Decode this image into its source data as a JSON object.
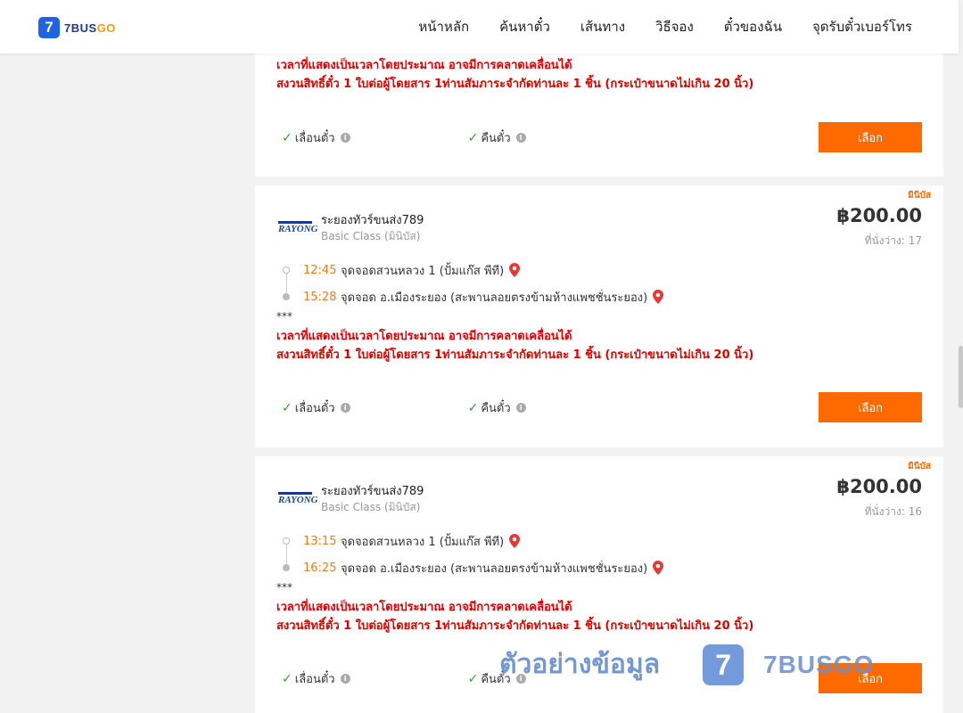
{
  "header": {
    "logo_text_main": "7BUS",
    "logo_text_accent": "GO",
    "logo_mark": "7",
    "nav": [
      "หน้าหลัก",
      "ค้นหาตั๋ว",
      "เส้นทาง",
      "วิธีจอง",
      "ตั๋วของฉัน",
      "จุดรับตั๋วเบอร์โทร"
    ]
  },
  "notice_lines": [
    "เวลาที่แสดงเป็นเวลาโดยประมาณ อาจมีการคลาดเคลื่อนได้",
    "สงวนสิทธิ์ตั๋ว 1 ใบต่อผู้โดยสาร 1ท่านสัมภาระจำกัดท่านละ 1 ชิ้น (กระเป๋าขนาดไม่เกิน 20 นิ้ว)"
  ],
  "features": {
    "change": "เลื่อนตั๋ว",
    "refund": "คืนตั๋ว"
  },
  "select_label": "เลือก",
  "trips": [
    {
      "tag": "มินิบัส",
      "operator": "ระยองทัวร์ขนส่ง789",
      "logo_text": "RAYONG",
      "class": "Basic Class (มินิบัส)",
      "price": "฿200.00",
      "seats": "ที่นั่งว่าง: 17",
      "depart_time": "12:45",
      "depart_place": "จุดจอดสวนหลวง 1 (ปั้มแก๊ส พีที)",
      "arrive_time": "15:28",
      "arrive_place": "จุดจอด อ.เมืองระยอง (สะพานลอยตรงข้ามห้างแพชชั่นระยอง)",
      "stars": "***"
    },
    {
      "tag": "มินิบัส",
      "operator": "ระยองทัวร์ขนส่ง789",
      "logo_text": "RAYONG",
      "class": "Basic Class (มินิบัส)",
      "price": "฿200.00",
      "seats": "ที่นั่งว่าง: 16",
      "depart_time": "13:15",
      "depart_place": "จุดจอดสวนหลวง 1 (ปั้มแก๊ส พีที)",
      "arrive_time": "16:25",
      "arrive_place": "จุดจอด อ.เมืองระยอง (สะพานลอยตรงข้ามห้างแพชชั่นระยอง)",
      "stars": "***"
    }
  ],
  "watermark": {
    "text": "ตัวอย่างข้อมูล",
    "mark": "7",
    "brand": "7BUSGO"
  }
}
